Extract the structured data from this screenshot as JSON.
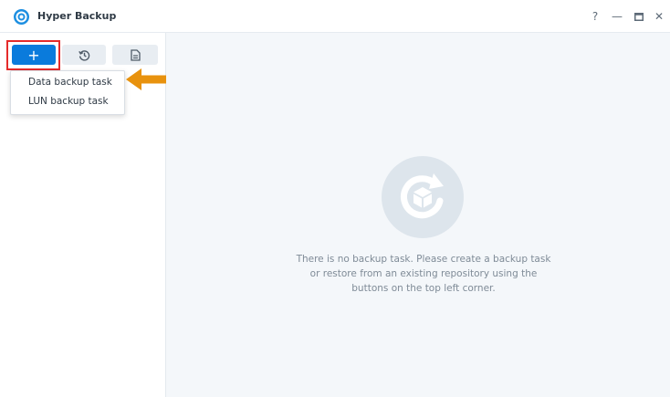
{
  "window": {
    "title": "Hyper Backup",
    "controls": {
      "help": "?",
      "minimize": "—",
      "maximize": "▭",
      "close": "✕"
    }
  },
  "toolbar": {
    "create_label": "+",
    "restore_icon": "history-icon",
    "log_icon": "document-icon"
  },
  "create_menu": {
    "items": [
      {
        "label": "Data backup task"
      },
      {
        "label": "LUN backup task"
      }
    ]
  },
  "empty_state": {
    "message": "There is no backup task. Please create a backup task or restore from an existing repository using the buttons on the top left corner."
  },
  "colors": {
    "accent": "#0a7bdc",
    "highlight": "#e52b2b",
    "arrow": "#e8920e",
    "main_background": "#f4f7fa"
  }
}
